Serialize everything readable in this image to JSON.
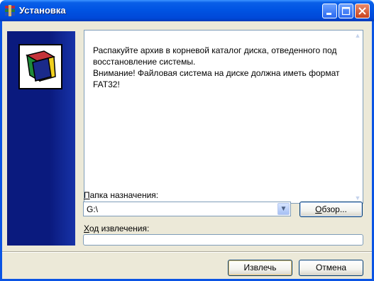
{
  "window": {
    "title": "Установка",
    "icon": "winrar-icon"
  },
  "titlebar": {
    "minimize_icon": "minimize-icon",
    "maximize_icon": "maximize-icon",
    "close_icon": "close-icon"
  },
  "info": {
    "text": "Распакуйте архив в корневой каталог диска, отведенного под восстановление системы.\nВнимание! Файловая система на диске должна иметь формат FAT32!"
  },
  "destination": {
    "label_mnemonic": "П",
    "label_rest": "апка назначения:",
    "value": "G:\\",
    "browse_mnemonic": "О",
    "browse_rest": "бзор..."
  },
  "progress": {
    "label_mnemonic": "Х",
    "label_rest": "од извлечения:",
    "value": 0
  },
  "buttons": {
    "extract_label": "Извлечь",
    "cancel_label": "Отмена"
  },
  "colors": {
    "titlebar": "#0054e3",
    "side_panel": "#0a1a7e",
    "dialog_bg": "#ece9d8"
  }
}
